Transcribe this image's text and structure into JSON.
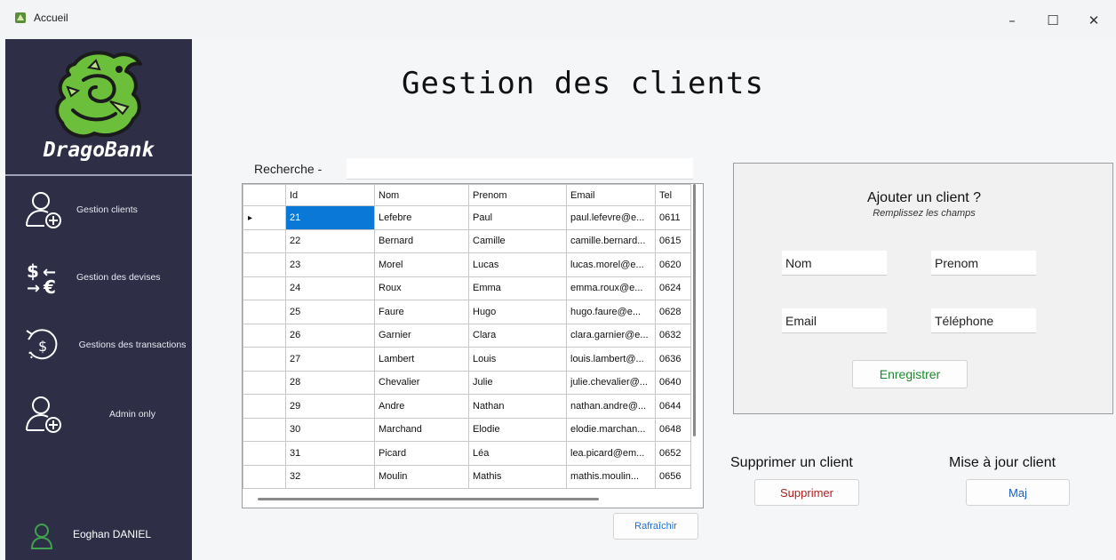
{
  "window": {
    "title": "Accueil",
    "controls": {
      "minimize": "–",
      "maximize": "☐",
      "close": "✕"
    }
  },
  "sidebar": {
    "brand": "DragoBank",
    "items": [
      {
        "label": "Gestion clients",
        "icon": "user-add-icon"
      },
      {
        "label": "Gestion des devises",
        "icon": "currency-exchange-icon"
      },
      {
        "label": "Gestions des transactions",
        "icon": "dollar-refresh-icon"
      },
      {
        "label": "Admin only",
        "icon": "user-add-icon"
      }
    ],
    "user": {
      "name": "Eoghan DANIEL",
      "icon": "user-icon"
    }
  },
  "main": {
    "title": "Gestion des clients",
    "search": {
      "label": "Recherche  -",
      "value": ""
    },
    "grid": {
      "columns": [
        "Id",
        "Nom",
        "Prenom",
        "Email",
        "Tel"
      ],
      "rows": [
        [
          "21",
          "Lefebre",
          "Paul",
          "paul.lefevre@e...",
          "0611"
        ],
        [
          "22",
          "Bernard",
          "Camille",
          "camille.bernard...",
          "0615"
        ],
        [
          "23",
          "Morel",
          "Lucas",
          "lucas.morel@e...",
          "0620"
        ],
        [
          "24",
          "Roux",
          "Emma",
          "emma.roux@e...",
          "0624"
        ],
        [
          "25",
          "Faure",
          "Hugo",
          "hugo.faure@e...",
          "0628"
        ],
        [
          "26",
          "Garnier",
          "Clara",
          "clara.garnier@e...",
          "0632"
        ],
        [
          "27",
          "Lambert",
          "Louis",
          "louis.lambert@...",
          "0636"
        ],
        [
          "28",
          "Chevalier",
          "Julie",
          "julie.chevalier@...",
          "0640"
        ],
        [
          "29",
          "Andre",
          "Nathan",
          "nathan.andre@...",
          "0644"
        ],
        [
          "30",
          "Marchand",
          "Elodie",
          "elodie.marchan...",
          "0648"
        ],
        [
          "31",
          "Picard",
          "Léa",
          "lea.picard@em...",
          "0652"
        ],
        [
          "32",
          "Moulin",
          "Mathis",
          "mathis.moulin...",
          "0656"
        ]
      ],
      "selected_row": 0,
      "selected_col": 0
    },
    "refresh_label": "Rafraîchir",
    "add_panel": {
      "title": "Ajouter un client ?",
      "subtitle": "Remplissez les champs",
      "fields": {
        "nom": "Nom",
        "prenom": "Prenom",
        "email": "Email",
        "telephone": "Téléphone"
      },
      "save_label": "Enregistrer"
    },
    "delete": {
      "label": "Supprimer un client",
      "button": "Supprimer"
    },
    "update": {
      "label": "Mise à jour client",
      "button": "Maj"
    }
  },
  "colors": {
    "sidebar_bg": "#2e2e46",
    "selection": "#0a78d7",
    "save_text": "#1a8a2a",
    "delete_text": "#b02020",
    "refresh_text": "#1e6fd0",
    "user_icon": "#3fa34d"
  }
}
